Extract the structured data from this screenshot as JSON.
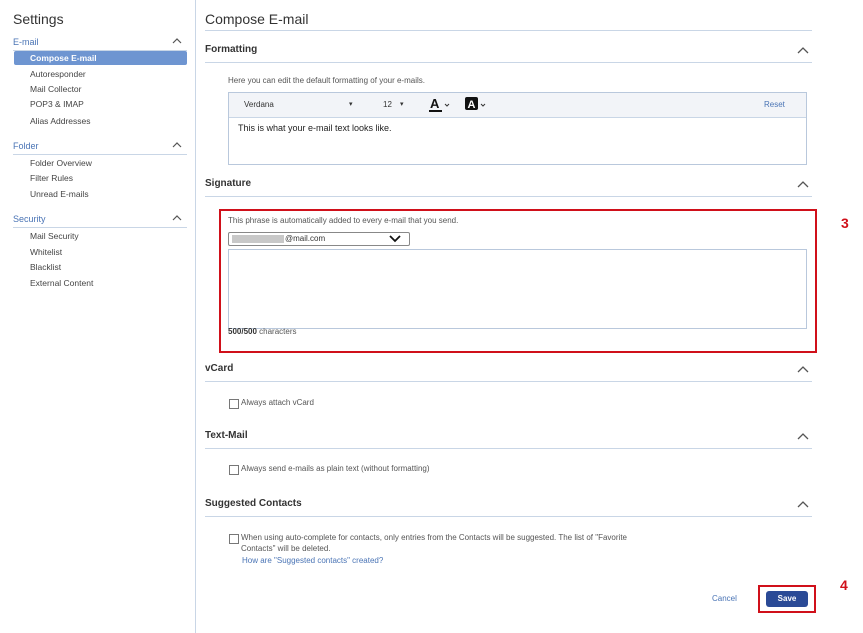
{
  "sidebar": {
    "title": "Settings",
    "groups": [
      {
        "label": "E-mail",
        "items": [
          "Compose E-mail",
          "Autoresponder",
          "Mail Collector",
          "POP3 & IMAP",
          "Alias Addresses"
        ]
      },
      {
        "label": "Folder",
        "items": [
          "Folder Overview",
          "Filter Rules",
          "Unread E-mails"
        ]
      },
      {
        "label": "Security",
        "items": [
          "Mail Security",
          "Whitelist",
          "Blacklist",
          "External Content"
        ]
      }
    ],
    "active_item": "Compose E-mail"
  },
  "main": {
    "title": "Compose E-mail",
    "formatting": {
      "heading": "Formatting",
      "hint": "Here you can edit the default formatting of your e-mails.",
      "font": "Verdana",
      "size": "12",
      "reset": "Reset",
      "preview_text": "This is what your e-mail text looks like."
    },
    "signature": {
      "heading": "Signature",
      "hint": "This phrase is automatically added to every e-mail that you send.",
      "account_domain": "@mail.com",
      "counter_value": "500/500",
      "counter_unit": "characters"
    },
    "vcard": {
      "heading": "vCard",
      "option": "Always attach vCard"
    },
    "textmail": {
      "heading": "Text-Mail",
      "option": "Always send e-mails as plain text (without formatting)"
    },
    "suggested": {
      "heading": "Suggested Contacts",
      "option_line1": "When using auto-complete for contacts, only entries from the Contacts will be suggested. The list of \"Favorite",
      "option_line2": "Contacts\" will be deleted.",
      "link": "How are \"Suggested contacts\" created?"
    },
    "actions": {
      "cancel": "Cancel",
      "save": "Save"
    }
  },
  "annotations": {
    "signature_marker": "3",
    "save_marker": "4"
  },
  "colors": {
    "accent": "#6e95d1",
    "primary_button": "#2a4a96",
    "annotation_red": "#d0101a",
    "link": "#4a74b5"
  }
}
